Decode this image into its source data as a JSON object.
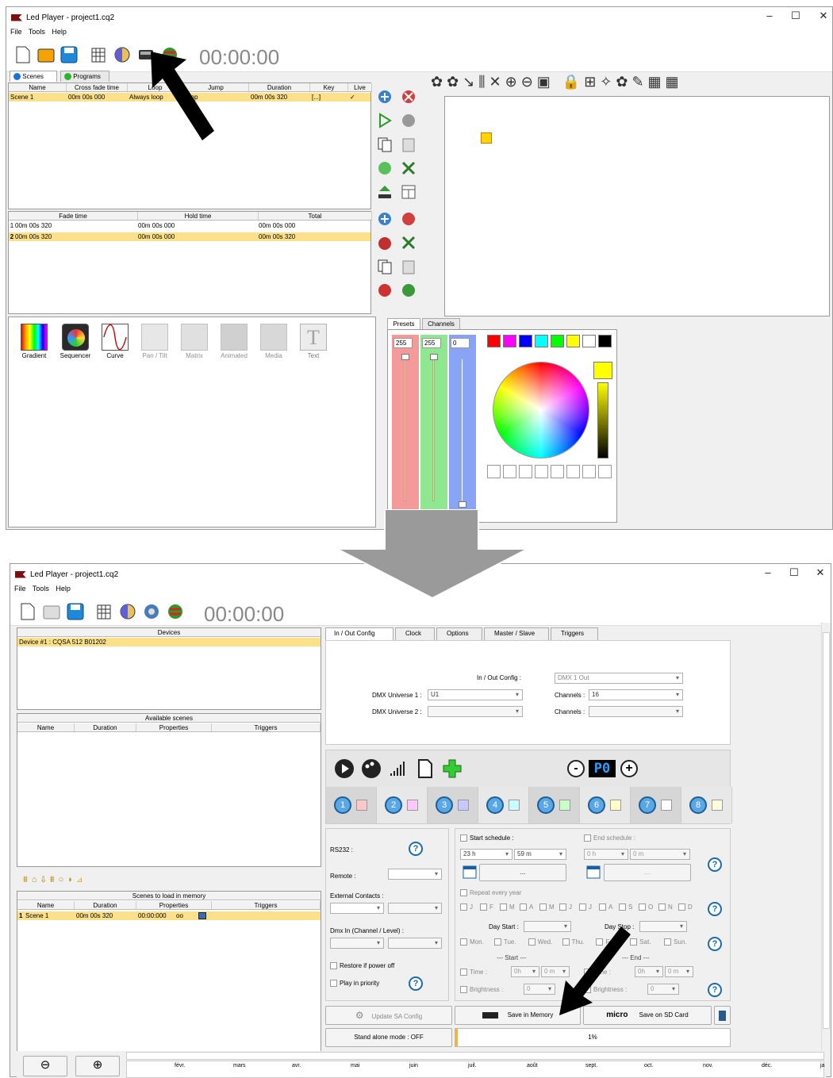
{
  "window1": {
    "title": "Led Player - project1.cq2",
    "menu": [
      "File",
      "Tools",
      "Help"
    ],
    "timer": "00:00:00",
    "tabs": [
      "Scenes",
      "Programs"
    ],
    "scenes_headers": [
      "Name",
      "Cross fade time",
      "Loop",
      "Jump",
      "Duration",
      "Key",
      "Live"
    ],
    "scene_row": [
      "Scene 1",
      "00m 00s 000",
      "Always loop",
      "Stop",
      "00m 00s 320",
      "[...]",
      "✓"
    ],
    "steps_headers": [
      "Fade time",
      "Hold time",
      "Total"
    ],
    "steps": [
      {
        "n": "1",
        "fade": "00m 00s 320",
        "hold": "00m 00s 000",
        "total": "00m 00s 000"
      },
      {
        "n": "2",
        "fade": "00m 00s 320",
        "hold": "00m 00s 000",
        "total": "00m 00s 320"
      }
    ],
    "effects": [
      "Gradient",
      "Sequencer",
      "Curve",
      "Pan / Tilt",
      "Matrix",
      "Animated",
      "Media",
      "Text"
    ],
    "bottom_tabs": [
      "Presets",
      "Channels"
    ],
    "rgb": [
      "255",
      "255",
      "0"
    ],
    "preset_colors": [
      "#ff0000",
      "#ff00ff",
      "#0000ff",
      "#00ffff",
      "#00ff00",
      "#ffff00",
      "#ffffff",
      "#000000"
    ],
    "current_color": "#ffff00"
  },
  "window2": {
    "title": "Led Player - project1.cq2",
    "menu": [
      "File",
      "Tools",
      "Help"
    ],
    "timer": "00:00:00",
    "devices_header": "Devices",
    "device_row": "Device #1 : CQSA 512 B01202",
    "available_header": "Available scenes",
    "avail_cols": [
      "Name",
      "Duration",
      "Properties",
      "Triggers"
    ],
    "memory_header": "Scenes to load in memory",
    "memory_cols": [
      "Name",
      "Duration",
      "Properties",
      "Triggers"
    ],
    "memory_row": {
      "n": "1",
      "name": "Scene 1",
      "duration": "00m 00s 320",
      "props": "00:00:000",
      "extra": "oo"
    },
    "tabs": [
      "In / Out Config",
      "Clock",
      "Options",
      "Master / Slave",
      "Triggers"
    ],
    "io_label": "In / Out Config :",
    "io_value": "DMX 1 Out",
    "dmx1_label": "DMX Universe 1 :",
    "dmx1_value": "U1",
    "dmx2_label": "DMX Universe 2 :",
    "channels_label": "Channels :",
    "channels_value": "16",
    "channels2_label": "Channels :",
    "mode_icons_sub": [
      "1",
      "2",
      "3",
      "4",
      "5"
    ],
    "program_display": "P0",
    "channels": [
      {
        "n": "1",
        "color": "#ffc8c8"
      },
      {
        "n": "2",
        "color": "#ffc8ff"
      },
      {
        "n": "3",
        "color": "#c8c8ff"
      },
      {
        "n": "4",
        "color": "#c8ffff"
      },
      {
        "n": "5",
        "color": "#c8ffc8"
      },
      {
        "n": "6",
        "color": "#ffffc8"
      },
      {
        "n": "7",
        "color": "#ffffff"
      },
      {
        "n": "8",
        "color": "#ffffe0"
      }
    ],
    "rs232": "RS232 :",
    "remote": "Remote :",
    "external": "External Contacts :",
    "dmxin": "Dmx In (Channel / Level) :",
    "restore": "Restore if power off",
    "priority": "Play in priority",
    "start_schedule": "Start schedule :",
    "end_schedule": "End schedule :",
    "start_h": "23 h",
    "start_m": "59 m",
    "end_h": "0 h",
    "end_m": "0 m",
    "date_dots": "...",
    "repeat": "Repeat every year",
    "months": [
      "J",
      "F",
      "M",
      "A",
      "M",
      "J",
      "J",
      "A",
      "S",
      "O",
      "N",
      "D"
    ],
    "day_start": "Day Start :",
    "day_stop": "Day Stop :",
    "days": [
      "Mon.",
      "Tue.",
      "Wed.",
      "Thu.",
      "Fri.",
      "Sat.",
      "Sun."
    ],
    "start_sec": "--- Start ---",
    "end_sec": "--- End ---",
    "time": "Time :",
    "time_h": "0h",
    "time_m": "0 m",
    "brightness": "Brightness :",
    "bright_val": "0",
    "update_btn": "Update SA Config",
    "save_mem_btn": "Save in Memory",
    "save_sd_btn": "Save on SD Card",
    "micro_label": "micro",
    "standalone": "Stand alone mode : OFF",
    "progress": "1%",
    "progress_value": 0.01,
    "timeline": [
      "févr.",
      "mars",
      "avr.",
      "mai",
      "juin",
      "juil.",
      "août",
      "sept.",
      "oct.",
      "nov.",
      "déc.",
      "ja"
    ]
  }
}
